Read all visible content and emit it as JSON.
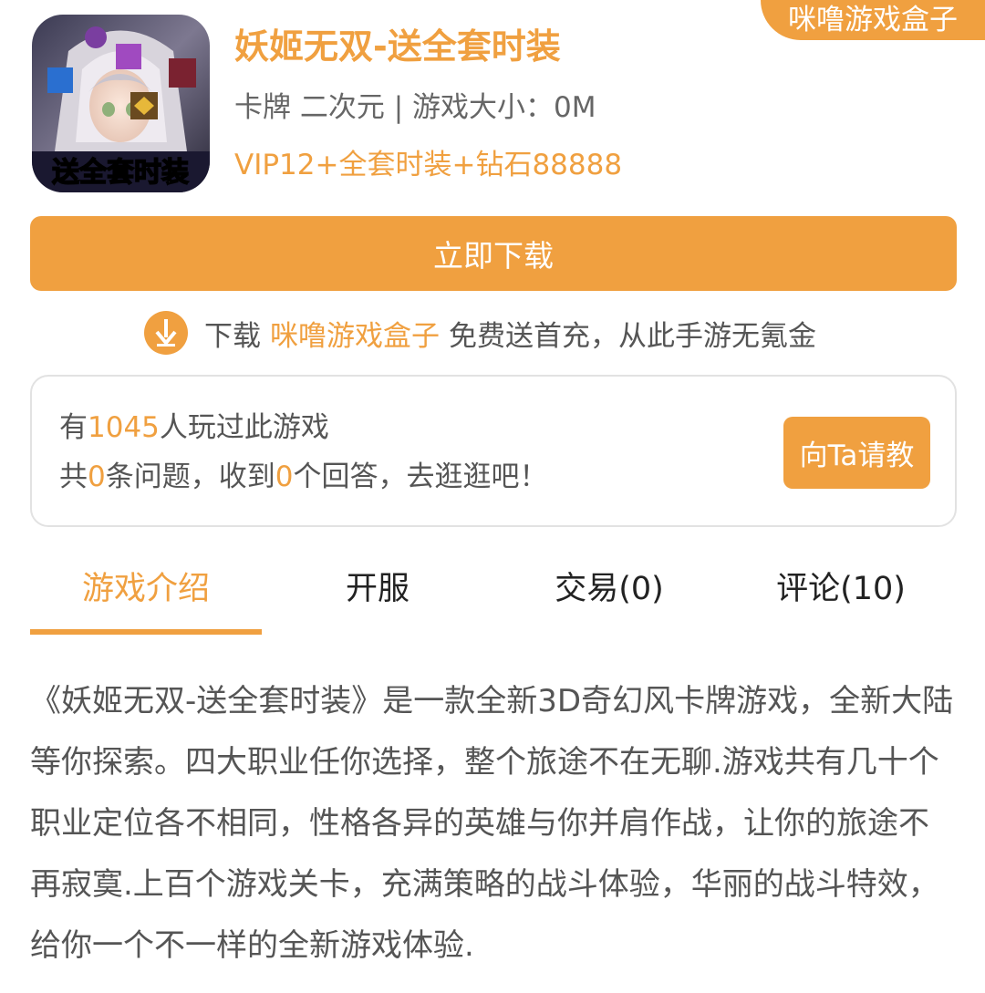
{
  "box_badge": {
    "label": "咪噜游戏盒子"
  },
  "game": {
    "title": "妖姬无双-送全套时装",
    "meta": "卡牌 二次元 | 游戏大小：0M",
    "promo": "VIP12+全套时装+钻石88888",
    "icon_caption": "送全套时装"
  },
  "download": {
    "button_label": "立即下载"
  },
  "tip": {
    "prefix": "下载",
    "link": "咪噜游戏盒子",
    "suffix": "免费送首充，从此手游无氪金"
  },
  "qa": {
    "line1_prefix": "有",
    "players": "1045",
    "line1_suffix": "人玩过此游戏",
    "line2_a": "共",
    "questions": "0",
    "line2_b": "条问题，收到",
    "answers": "0",
    "line2_c": "个回答，去逛逛吧！",
    "ask_button": "向Ta请教"
  },
  "tabs": [
    {
      "label": "游戏介绍",
      "active": true
    },
    {
      "label": "开服",
      "active": false
    },
    {
      "label": "交易(0)",
      "active": false
    },
    {
      "label": "评论(10)",
      "active": false
    }
  ],
  "intro": {
    "text": "《妖姬无双-送全套时装》是一款全新3D奇幻风卡牌游戏，全新大陆等你探索。四大职业任你选择，整个旅途不在无聊.游戏共有几十个职业定位各不相同，性格各异的英雄与你并肩作战，让你的旅途不再寂寞.上百个游戏关卡，充满策略的战斗体验，华丽的战斗特效，给你一个不一样的全新游戏体验."
  },
  "colors": {
    "accent": "#f0a040",
    "text": "#555555",
    "border": "#e2e2e2"
  },
  "icons": [
    "download-arrow-icon",
    "game-app-icon"
  ]
}
